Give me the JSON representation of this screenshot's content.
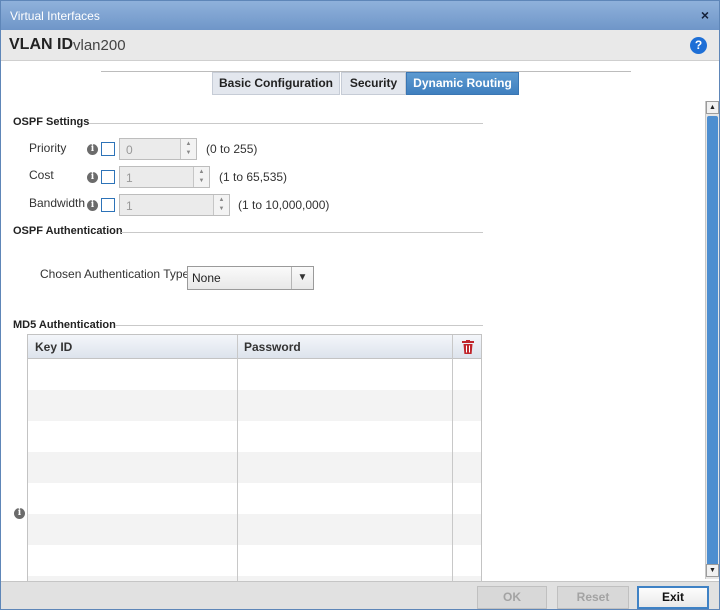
{
  "window": {
    "title": "Virtual Interfaces",
    "close_glyph": "×"
  },
  "header": {
    "label": "VLAN ID",
    "value": "vlan200",
    "help_glyph": "?"
  },
  "tabs": [
    {
      "label": "Basic Configuration",
      "active": false
    },
    {
      "label": "Security",
      "active": false
    },
    {
      "label": "Dynamic Routing",
      "active": true
    }
  ],
  "ospf": {
    "title": "OSPF Settings",
    "fields": [
      {
        "label": "Priority",
        "value": "0",
        "range": "(0 to 255)"
      },
      {
        "label": "Cost",
        "value": "1",
        "range": "(1 to 65,535)"
      },
      {
        "label": "Bandwidth",
        "value": "1",
        "range": "(1 to 10,000,000)"
      }
    ]
  },
  "auth": {
    "title": "OSPF Authentication",
    "type_label": "Chosen Authentication Type",
    "type_value": "None"
  },
  "md5": {
    "title": "MD5 Authentication",
    "columns": [
      "Key ID",
      "Password"
    ]
  },
  "footer": {
    "ok": "OK",
    "reset": "Reset",
    "exit": "Exit"
  },
  "icons": {
    "info": "info-icon",
    "delete": "trash-icon",
    "help": "help-icon",
    "close": "close-icon"
  },
  "colors": {
    "accent": "#3f7fbf",
    "delete": "#c0262c",
    "help": "#1e6fd6"
  }
}
